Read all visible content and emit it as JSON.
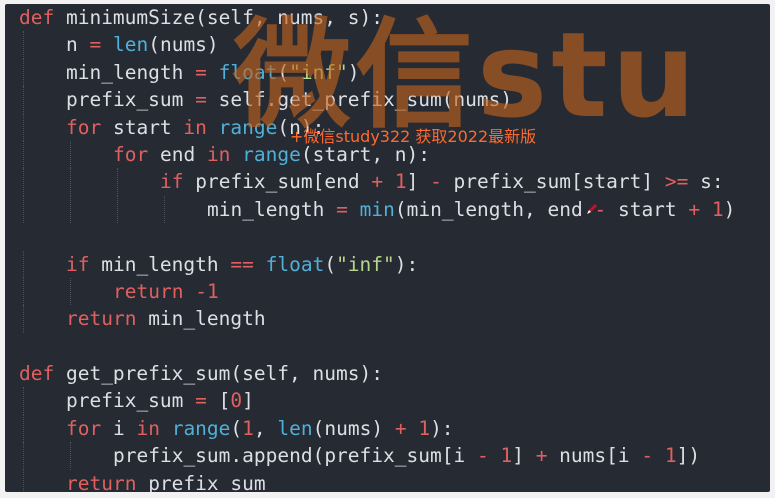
{
  "watermark": {
    "large": "微信stu",
    "small": "+微信study322 获取2022最新版"
  },
  "code_lines": [
    {
      "indent": 0,
      "tokens": [
        {
          "c": "kw",
          "t": "def"
        },
        {
          "c": "pl",
          "t": " minimumSize(self, nums, s):"
        }
      ]
    },
    {
      "indent": 1,
      "tokens": [
        {
          "c": "pl",
          "t": "n "
        },
        {
          "c": "op",
          "t": "="
        },
        {
          "c": "pl",
          "t": " "
        },
        {
          "c": "bi",
          "t": "len"
        },
        {
          "c": "pl",
          "t": "(nums)"
        }
      ]
    },
    {
      "indent": 1,
      "tokens": [
        {
          "c": "pl",
          "t": "min_length "
        },
        {
          "c": "op",
          "t": "="
        },
        {
          "c": "pl",
          "t": " "
        },
        {
          "c": "bi",
          "t": "float"
        },
        {
          "c": "pl",
          "t": "("
        },
        {
          "c": "st",
          "t": "\"inf\""
        },
        {
          "c": "pl",
          "t": ")"
        }
      ]
    },
    {
      "indent": 1,
      "tokens": [
        {
          "c": "pl",
          "t": "prefix_sum "
        },
        {
          "c": "op",
          "t": "="
        },
        {
          "c": "pl",
          "t": " self.get_prefix_sum(nums)"
        }
      ]
    },
    {
      "indent": 1,
      "tokens": [
        {
          "c": "kw",
          "t": "for"
        },
        {
          "c": "pl",
          "t": " start "
        },
        {
          "c": "kw",
          "t": "in"
        },
        {
          "c": "pl",
          "t": " "
        },
        {
          "c": "bi",
          "t": "range"
        },
        {
          "c": "pl",
          "t": "(n):"
        }
      ]
    },
    {
      "indent": 2,
      "tokens": [
        {
          "c": "kw",
          "t": "for"
        },
        {
          "c": "pl",
          "t": " end "
        },
        {
          "c": "kw",
          "t": "in"
        },
        {
          "c": "pl",
          "t": " "
        },
        {
          "c": "bi",
          "t": "range"
        },
        {
          "c": "pl",
          "t": "(start, n):"
        }
      ]
    },
    {
      "indent": 3,
      "tokens": [
        {
          "c": "kw",
          "t": "if"
        },
        {
          "c": "pl",
          "t": " prefix_sum[end "
        },
        {
          "c": "op",
          "t": "+"
        },
        {
          "c": "pl",
          "t": " "
        },
        {
          "c": "nu",
          "t": "1"
        },
        {
          "c": "pl",
          "t": "] "
        },
        {
          "c": "op",
          "t": "-"
        },
        {
          "c": "pl",
          "t": " prefix_sum[start] "
        },
        {
          "c": "op",
          "t": ">="
        },
        {
          "c": "pl",
          "t": " s:"
        }
      ]
    },
    {
      "indent": 4,
      "tokens": [
        {
          "c": "pl",
          "t": "min_length "
        },
        {
          "c": "op",
          "t": "="
        },
        {
          "c": "pl",
          "t": " "
        },
        {
          "c": "bi",
          "t": "min"
        },
        {
          "c": "pl",
          "t": "(min_length, end "
        },
        {
          "c": "op",
          "t": "-"
        },
        {
          "c": "pl",
          "t": " start "
        },
        {
          "c": "op",
          "t": "+"
        },
        {
          "c": "pl",
          "t": " "
        },
        {
          "c": "nu",
          "t": "1"
        },
        {
          "c": "pl",
          "t": ")"
        }
      ]
    },
    {
      "indent": 0,
      "tokens": []
    },
    {
      "indent": 1,
      "tokens": [
        {
          "c": "kw",
          "t": "if"
        },
        {
          "c": "pl",
          "t": " min_length "
        },
        {
          "c": "op",
          "t": "=="
        },
        {
          "c": "pl",
          "t": " "
        },
        {
          "c": "bi",
          "t": "float"
        },
        {
          "c": "pl",
          "t": "("
        },
        {
          "c": "st",
          "t": "\"inf\""
        },
        {
          "c": "pl",
          "t": "):"
        }
      ]
    },
    {
      "indent": 2,
      "tokens": [
        {
          "c": "kw",
          "t": "return"
        },
        {
          "c": "pl",
          "t": " "
        },
        {
          "c": "nu",
          "t": "-1"
        }
      ]
    },
    {
      "indent": 1,
      "tokens": [
        {
          "c": "kw",
          "t": "return"
        },
        {
          "c": "pl",
          "t": " min_length"
        }
      ]
    },
    {
      "indent": 0,
      "tokens": []
    },
    {
      "indent": 0,
      "tokens": [
        {
          "c": "kw",
          "t": "def"
        },
        {
          "c": "pl",
          "t": " get_prefix_sum(self, nums):"
        }
      ]
    },
    {
      "indent": 1,
      "tokens": [
        {
          "c": "pl",
          "t": "prefix_sum "
        },
        {
          "c": "op",
          "t": "="
        },
        {
          "c": "pl",
          "t": " ["
        },
        {
          "c": "nu",
          "t": "0"
        },
        {
          "c": "pl",
          "t": "]"
        }
      ]
    },
    {
      "indent": 1,
      "tokens": [
        {
          "c": "kw",
          "t": "for"
        },
        {
          "c": "pl",
          "t": " i "
        },
        {
          "c": "kw",
          "t": "in"
        },
        {
          "c": "pl",
          "t": " "
        },
        {
          "c": "bi",
          "t": "range"
        },
        {
          "c": "pl",
          "t": "("
        },
        {
          "c": "nu",
          "t": "1"
        },
        {
          "c": "pl",
          "t": ", "
        },
        {
          "c": "bi",
          "t": "len"
        },
        {
          "c": "pl",
          "t": "(nums) "
        },
        {
          "c": "op",
          "t": "+"
        },
        {
          "c": "pl",
          "t": " "
        },
        {
          "c": "nu",
          "t": "1"
        },
        {
          "c": "pl",
          "t": "):"
        }
      ]
    },
    {
      "indent": 2,
      "tokens": [
        {
          "c": "pl",
          "t": "prefix_sum.append(prefix_sum[i "
        },
        {
          "c": "op",
          "t": "-"
        },
        {
          "c": "pl",
          "t": " "
        },
        {
          "c": "nu",
          "t": "1"
        },
        {
          "c": "pl",
          "t": "] "
        },
        {
          "c": "op",
          "t": "+"
        },
        {
          "c": "pl",
          "t": " nums[i "
        },
        {
          "c": "op",
          "t": "-"
        },
        {
          "c": "pl",
          "t": " "
        },
        {
          "c": "nu",
          "t": "1"
        },
        {
          "c": "pl",
          "t": "])"
        }
      ]
    },
    {
      "indent": 1,
      "tokens": [
        {
          "c": "kw",
          "t": "return"
        },
        {
          "c": "pl",
          "t": " prefix_sum"
        }
      ]
    }
  ],
  "colors": {
    "background": "#262a33",
    "keyword": "#e0605f",
    "builtin": "#4fb0d8",
    "string": "#b6d68a",
    "text": "#dcdfe4",
    "watermark": "#c4621c"
  },
  "icons": {
    "cursor": "pen-cursor-icon"
  }
}
